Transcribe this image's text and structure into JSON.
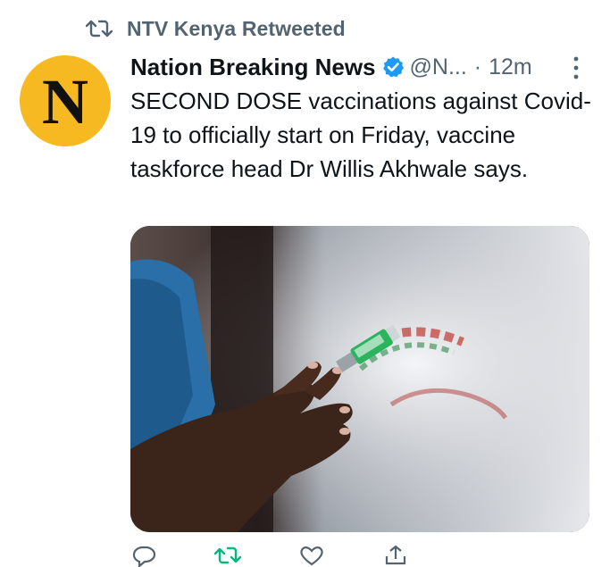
{
  "retweet_banner": {
    "text": "NTV Kenya Retweeted",
    "icon": "retweet-icon"
  },
  "author": {
    "avatar_letter": "N",
    "avatar_color": "#f6b921",
    "display_name": "Nation Breaking News",
    "verified": true,
    "handle": "@N...",
    "separator": "·",
    "time": "12m"
  },
  "tweet": {
    "text": "SECOND DOSE vaccinations against Covid-19 to officially start on Friday, vaccine taskforce head Dr Willis Akhwale says."
  },
  "media": {
    "type": "photo"
  },
  "actions": [
    {
      "name": "reply",
      "icon": "reply-icon"
    },
    {
      "name": "retweet",
      "icon": "retweet-icon",
      "active_color": "#00ba7c"
    },
    {
      "name": "like",
      "icon": "heart-icon"
    },
    {
      "name": "share",
      "icon": "share-icon"
    }
  ],
  "colors": {
    "secondary_text": "#536471",
    "primary_text": "#0f1419",
    "verified_blue": "#1d9bf0",
    "retweet_green": "#00ba7c"
  }
}
